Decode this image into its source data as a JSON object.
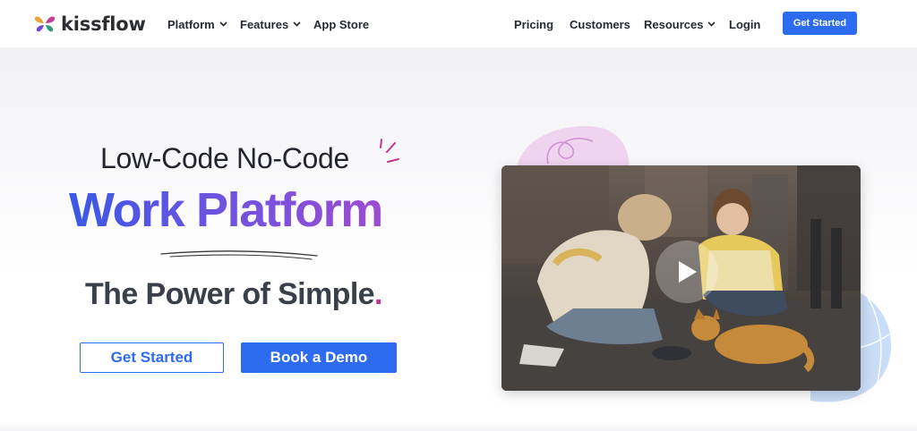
{
  "brand": {
    "name": "kissflow",
    "logo_icon": "butterfly-logo-icon",
    "logo_colors": [
      "#e8a43a",
      "#c23c8f",
      "#6f4ad6",
      "#2f9a76"
    ]
  },
  "nav": {
    "left_items": [
      {
        "label": "Platform",
        "has_dropdown": true
      },
      {
        "label": "Features",
        "has_dropdown": true
      },
      {
        "label": "App Store",
        "has_dropdown": false
      }
    ],
    "right_items": [
      {
        "label": "Pricing",
        "has_dropdown": false
      },
      {
        "label": "Customers",
        "has_dropdown": false
      },
      {
        "label": "Resources",
        "has_dropdown": true
      },
      {
        "label": "Login",
        "has_dropdown": false
      }
    ],
    "cta_label": "Get Started"
  },
  "hero": {
    "line1": "Low-Code No-Code",
    "line2": "Work Platform",
    "tagline": "The Power of Simple",
    "tagline_dot": ".",
    "primary_button": "Get Started",
    "secondary_button": "Book a Demo",
    "video_icon": "play-icon"
  },
  "colors": {
    "accent": "#2d6cf0",
    "gradient_start": "#3a58e6",
    "gradient_end": "#9d4bd2",
    "tagline_dot": "#c0368f",
    "deco_pink": "#efd3ef",
    "deco_blue": "#c9ddf8"
  }
}
